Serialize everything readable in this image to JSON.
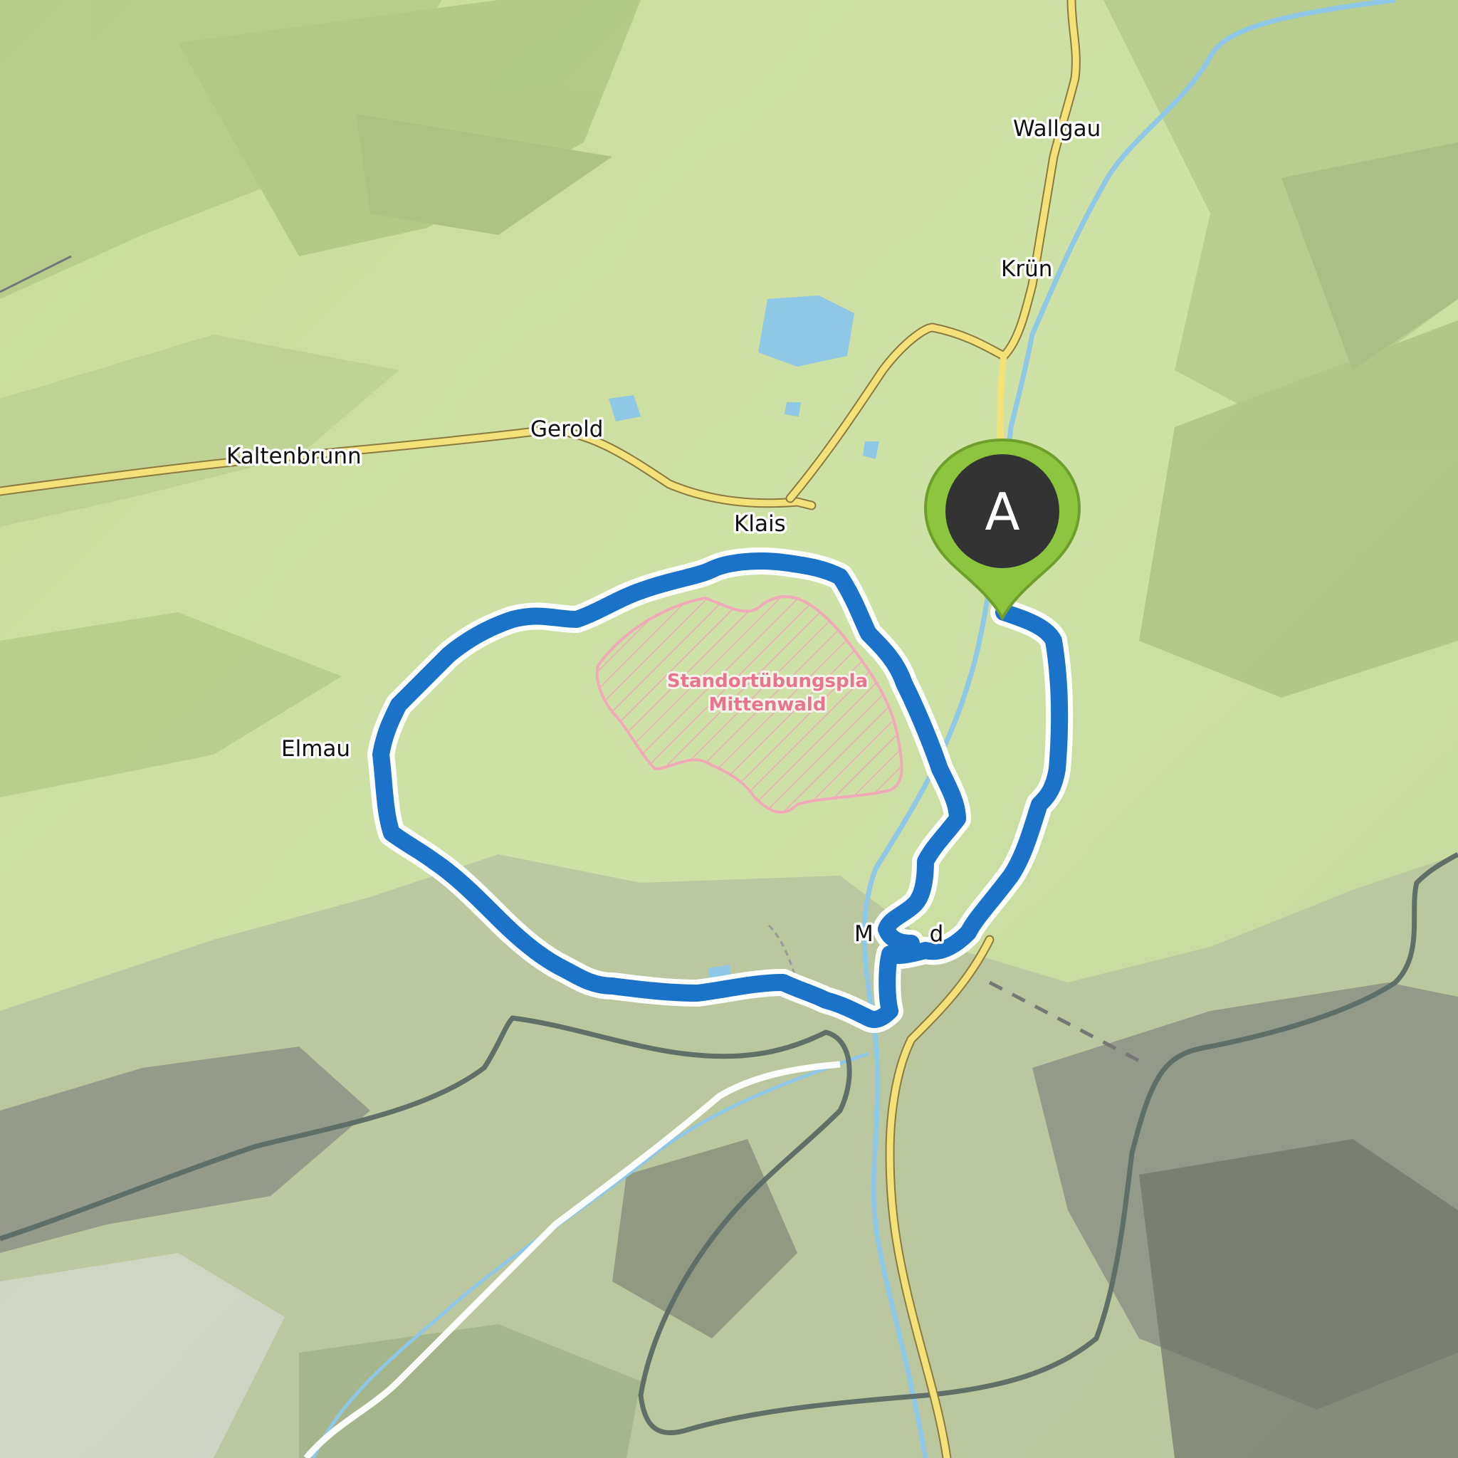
{
  "map": {
    "places": [
      {
        "id": "wallgau",
        "name": "Wallgau"
      },
      {
        "id": "kruen",
        "name": "Krün"
      },
      {
        "id": "gerold",
        "name": "Gerold"
      },
      {
        "id": "kaltenbrunn",
        "name": "Kaltenbrunn"
      },
      {
        "id": "klais",
        "name": "Klais"
      },
      {
        "id": "elmau",
        "name": "Elmau"
      },
      {
        "id": "mittenwald",
        "name": "M        d"
      }
    ],
    "restricted_area": {
      "line1": "Standortübungspla",
      "line2": "Mittenwald"
    },
    "start_marker": {
      "letter": "A",
      "color": "#8cc63f"
    },
    "route_color": "#1a73c8",
    "road_color": "#f3e27a",
    "border_color": "#5b6b66",
    "water_color": "#8fc7e6"
  }
}
